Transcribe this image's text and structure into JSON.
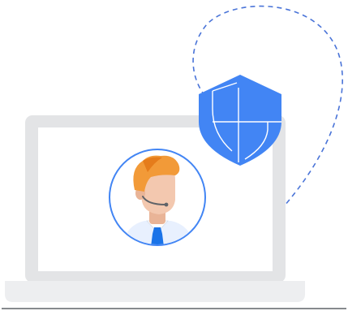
{
  "illustration": {
    "colors": {
      "shield_blue": "#4285F4",
      "shield_line": "#FFFFFF",
      "dashed_stroke": "#4A74D8",
      "laptop_frame": "#E3E4E6",
      "laptop_base": "#EDEEF0",
      "laptop_floor_line": "#5F6368",
      "avatar_ring": "#4285F4",
      "hair": "#F29A38",
      "hair_dark": "#E57C1B",
      "skin": "#F3C8AF",
      "skin_shadow": "#E9B497",
      "shirt": "#E8F0FE",
      "tie": "#1A73E8",
      "headset": "#5F6368"
    },
    "icons": [
      "laptop-icon",
      "shield-icon",
      "support-agent-avatar-icon"
    ]
  }
}
